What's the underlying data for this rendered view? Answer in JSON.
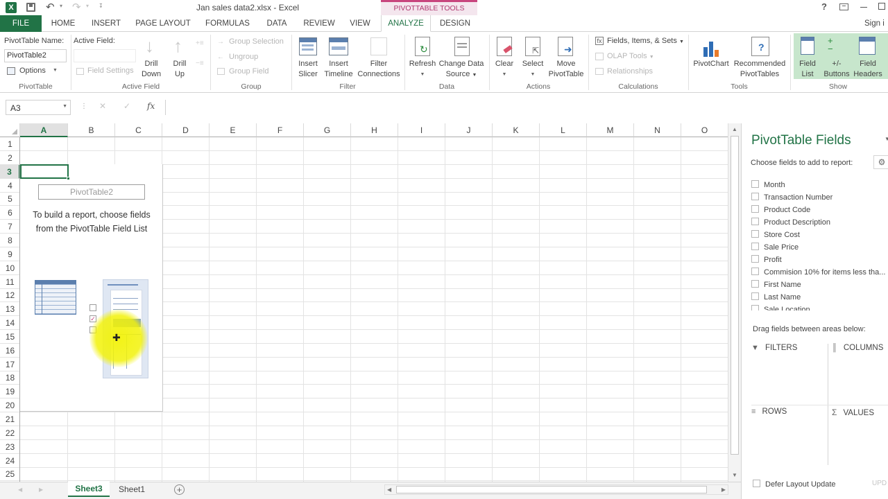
{
  "window": {
    "title": "Jan sales data2.xlsx - Excel",
    "contextual_tab_group": "PIVOTTABLE TOOLS",
    "sign_in": "Sign i"
  },
  "tabs": [
    {
      "label": "FILE"
    },
    {
      "label": "HOME"
    },
    {
      "label": "INSERT"
    },
    {
      "label": "PAGE LAYOUT"
    },
    {
      "label": "FORMULAS"
    },
    {
      "label": "DATA"
    },
    {
      "label": "REVIEW"
    },
    {
      "label": "VIEW"
    },
    {
      "label": "ANALYZE"
    },
    {
      "label": "DESIGN"
    }
  ],
  "ribbon": {
    "pivottable": {
      "name_label": "PivotTable Name:",
      "name_value": "PivotTable2",
      "options": "Options",
      "group": "PivotTable"
    },
    "active_field": {
      "label": "Active Field:",
      "field_settings": "Field Settings",
      "drill_down": "Drill Down",
      "drill_down_1": "Drill",
      "drill_down_2": "Down",
      "drill_up_1": "Drill",
      "drill_up_2": "Up",
      "group": "Active Field"
    },
    "group_grp": {
      "group_selection": "Group Selection",
      "ungroup": "Ungroup",
      "group_field": "Group Field",
      "group": "Group"
    },
    "filter": {
      "insert_slicer_1": "Insert",
      "insert_slicer_2": "Slicer",
      "insert_timeline_1": "Insert",
      "insert_timeline_2": "Timeline",
      "filter_conn_1": "Filter",
      "filter_conn_2": "Connections",
      "group": "Filter"
    },
    "data": {
      "refresh": "Refresh",
      "change_source_1": "Change Data",
      "change_source_2": "Source",
      "group": "Data"
    },
    "actions": {
      "clear": "Clear",
      "select": "Select",
      "move_1": "Move",
      "move_2": "PivotTable",
      "group": "Actions"
    },
    "calculations": {
      "fields_items": "Fields, Items, & Sets",
      "olap": "OLAP Tools",
      "relationships": "Relationships",
      "group": "Calculations"
    },
    "tools": {
      "pivotchart": "PivotChart",
      "recommended_1": "Recommended",
      "recommended_2": "PivotTables",
      "group": "Tools"
    },
    "show": {
      "field_list_1": "Field",
      "field_list_2": "List",
      "buttons_1": "+/-",
      "buttons_2": "Buttons",
      "headers_1": "Field",
      "headers_2": "Headers",
      "group": "Show"
    }
  },
  "formula_bar": {
    "name_box": "A3",
    "fx": "fx",
    "value": ""
  },
  "grid": {
    "columns": [
      "A",
      "B",
      "C",
      "D",
      "E",
      "F",
      "G",
      "H",
      "I",
      "J",
      "K",
      "L",
      "M",
      "N",
      "O"
    ],
    "rows": [
      "1",
      "2",
      "3",
      "4",
      "5",
      "6",
      "7",
      "8",
      "9",
      "10",
      "11",
      "12",
      "13",
      "14",
      "15",
      "16",
      "17",
      "18",
      "19",
      "20",
      "21",
      "22",
      "23",
      "24",
      "25"
    ],
    "placeholder_name": "PivotTable2",
    "placeholder_line1": "To build a report, choose fields",
    "placeholder_line2": "from the PivotTable Field List"
  },
  "field_panel": {
    "title": "PivotTable Fields",
    "subtitle": "Choose fields to add to report:",
    "fields": [
      {
        "label": "Month"
      },
      {
        "label": "Transaction Number"
      },
      {
        "label": "Product Code"
      },
      {
        "label": "Product Description"
      },
      {
        "label": "Store Cost"
      },
      {
        "label": "Sale Price"
      },
      {
        "label": "Profit"
      },
      {
        "label": "Commision 10% for items less tha..."
      },
      {
        "label": "First Name"
      },
      {
        "label": "Last Name"
      },
      {
        "label": "Sale Location"
      }
    ],
    "drag_label": "Drag fields between areas below:",
    "filters": "FILTERS",
    "columns": "COLUMNS",
    "rows": "ROWS",
    "values": "VALUES",
    "defer_update": "Defer Layout Update",
    "update_button": "UPD"
  },
  "sheet_tabs": [
    {
      "label": "Sheet3",
      "active": true
    },
    {
      "label": "Sheet1",
      "active": false
    }
  ],
  "colors": {
    "excel_green": "#217346",
    "pivot_pink": "#c8457e",
    "highlight_yellow": "#f2f20a"
  }
}
